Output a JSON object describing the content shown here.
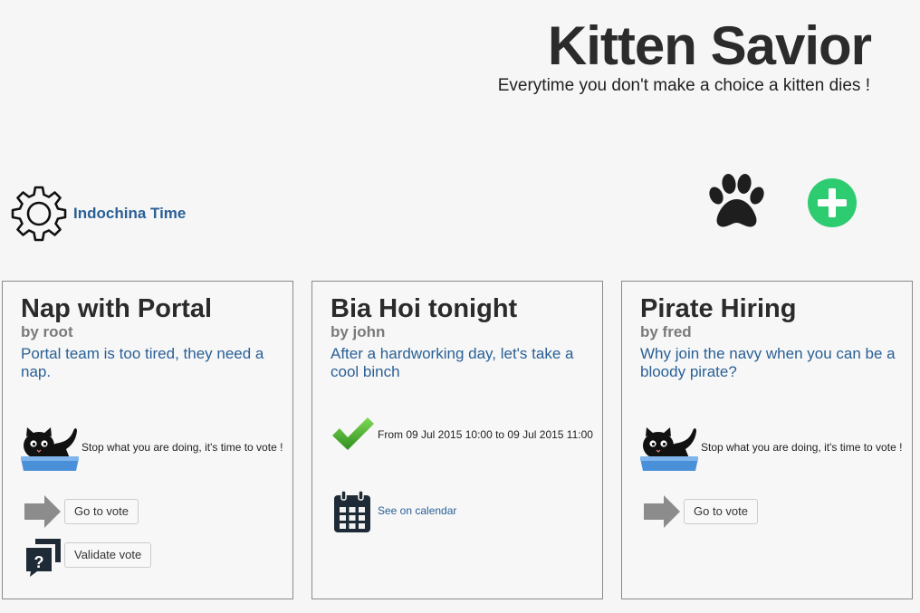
{
  "header": {
    "title": "Kitten Savior",
    "subtitle": "Everytime you don't make a choice a kitten dies !"
  },
  "toolbar": {
    "timezone": "Indochina Time",
    "icons": [
      "gear-icon",
      "paw-icon",
      "plus-circle-icon"
    ],
    "add_color": "#2ecc71"
  },
  "cards": [
    {
      "title": "Nap with Portal",
      "author": "by root",
      "description": "Portal team is too tired, they need a nap.",
      "status_text": "Stop what you are doing, it's time to vote !",
      "go_to_vote": "Go to vote",
      "validate_vote": "Validate vote"
    },
    {
      "title": "Bia Hoi tonight",
      "author": "by john",
      "description": "After a hardworking day, let's take a cool binch",
      "date_range": "From 09 Jul 2015 10:00 to 09 Jul 2015 11:00",
      "calendar_link": "See on calendar"
    },
    {
      "title": "Pirate Hiring",
      "author": "by fred",
      "description": "Why join the navy when you can be a bloody pirate?",
      "status_text": "Stop what you are doing, it's time to vote !",
      "go_to_vote": "Go to vote"
    }
  ],
  "colors": {
    "link": "#2a6096",
    "title": "#2b2b2b",
    "author": "#7a7a7a",
    "checkmark": "#4caf32",
    "litter_box": "#4a90d9"
  }
}
